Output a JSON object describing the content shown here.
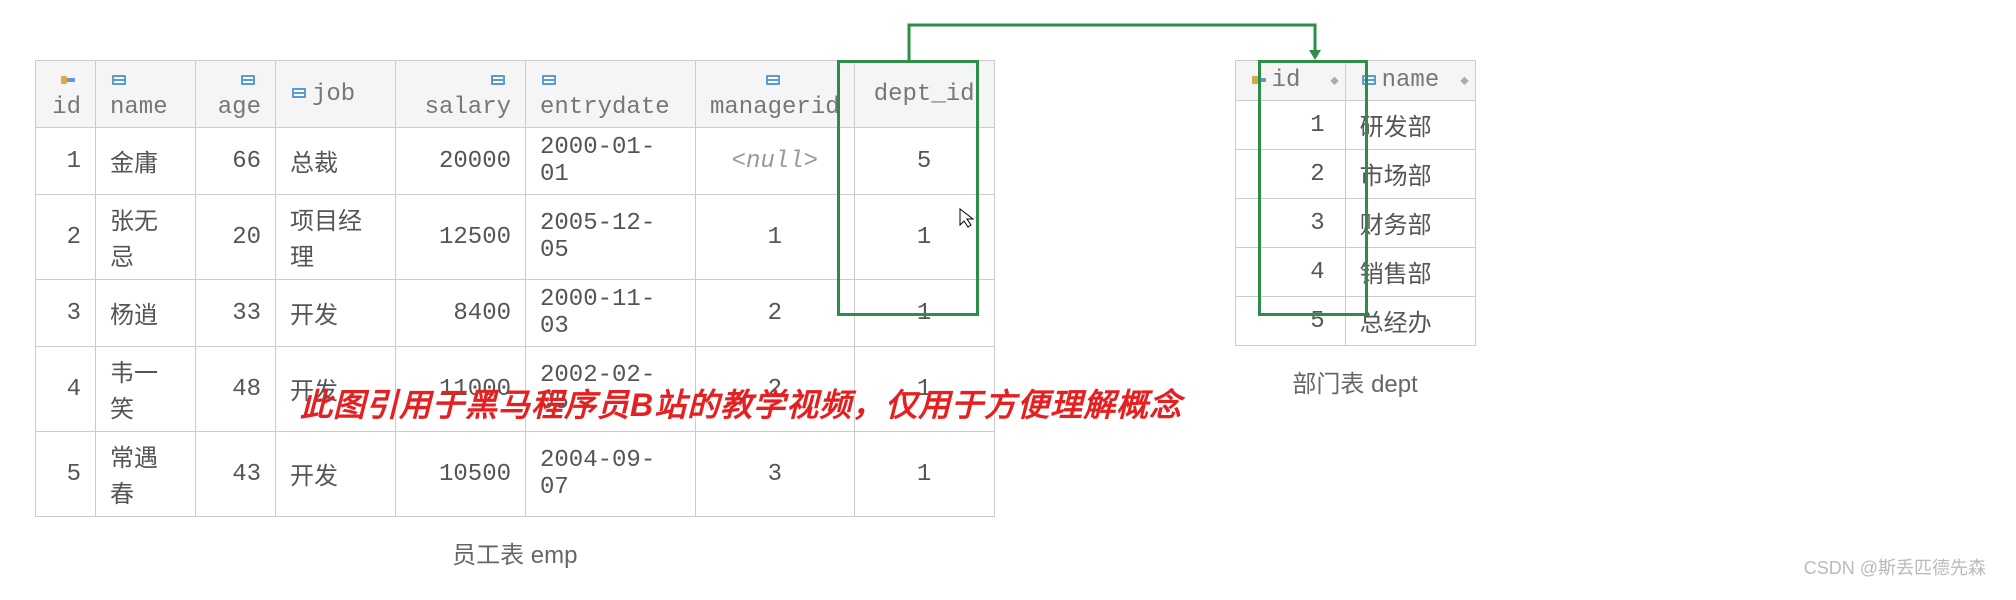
{
  "emp_table": {
    "caption": "员工表 emp",
    "columns": [
      "id",
      "name",
      "age",
      "job",
      "salary",
      "entrydate",
      "managerid",
      "dept_id"
    ],
    "rows": [
      {
        "id": "1",
        "name": "金庸",
        "age": "66",
        "job": "总裁",
        "salary": "20000",
        "entrydate": "2000-01-01",
        "managerid": "<null>",
        "dept_id": "5"
      },
      {
        "id": "2",
        "name": "张无忌",
        "age": "20",
        "job": "项目经理",
        "salary": "12500",
        "entrydate": "2005-12-05",
        "managerid": "1",
        "dept_id": "1"
      },
      {
        "id": "3",
        "name": "杨逍",
        "age": "33",
        "job": "开发",
        "salary": "8400",
        "entrydate": "2000-11-03",
        "managerid": "2",
        "dept_id": "1"
      },
      {
        "id": "4",
        "name": "韦一笑",
        "age": "48",
        "job": "开发",
        "salary": "11000",
        "entrydate": "2002-02-05",
        "managerid": "2",
        "dept_id": "1"
      },
      {
        "id": "5",
        "name": "常遇春",
        "age": "43",
        "job": "开发",
        "salary": "10500",
        "entrydate": "2004-09-07",
        "managerid": "3",
        "dept_id": "1"
      }
    ]
  },
  "dept_table": {
    "caption": "部门表 dept",
    "columns": [
      "id",
      "name"
    ],
    "rows": [
      {
        "id": "1",
        "name": "研发部"
      },
      {
        "id": "2",
        "name": "市场部"
      },
      {
        "id": "3",
        "name": "财务部"
      },
      {
        "id": "4",
        "name": "销售部"
      },
      {
        "id": "5",
        "name": "总经办"
      }
    ]
  },
  "note": "此图引用于黑马程序员B站的教学视频，仅用于方便理解概念",
  "watermark": "CSDN @斯丢匹德先森",
  "highlight_color": "#2d8f47",
  "icons": {
    "pk": "primary-key-column-icon",
    "col": "column-icon",
    "sort": "sort-icon"
  }
}
